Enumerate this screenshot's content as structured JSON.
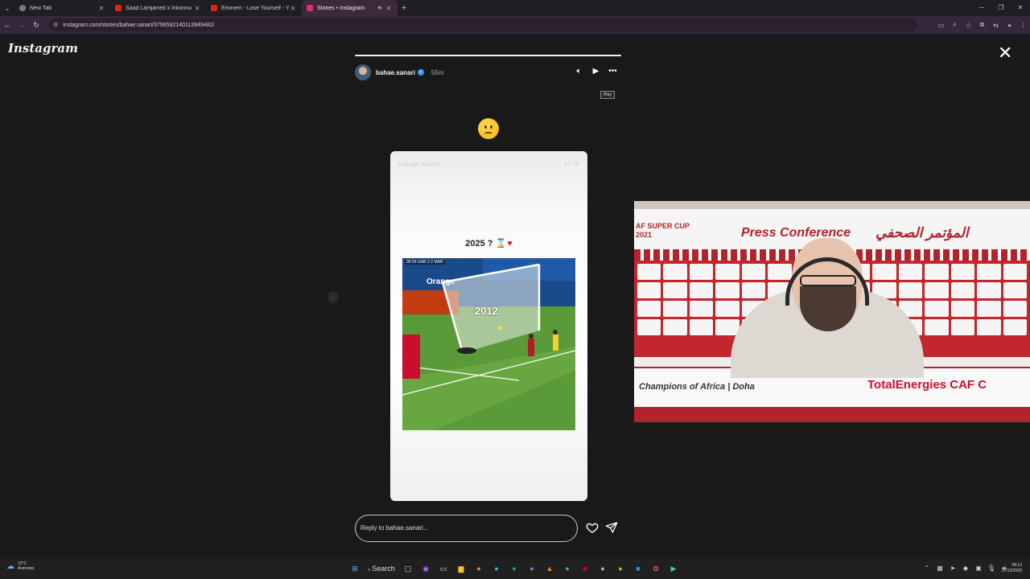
{
  "browser": {
    "tabs": [
      {
        "title": "New Tab",
        "favicon_color": "#7a7a7a",
        "active": false
      },
      {
        "title": "Saad Lamjarred x Inkonnu x Afri",
        "favicon_color": "#e62117",
        "active": false
      },
      {
        "title": "Eminem - Lose Yourself - YouTu",
        "favicon_color": "#e62117",
        "active": false
      },
      {
        "title": "Stories • Instagram",
        "favicon_color": "#e1306c",
        "active": true
      }
    ],
    "url": "instagram.com/stories/bahae.sanari/3796592140113949482/"
  },
  "page": {
    "logo": "Instagram",
    "close_icon": "close-icon"
  },
  "story": {
    "username": "bahae.sanari",
    "time_ago": "55m",
    "tooltip": "Play",
    "card": {
      "username": "bahae.sanari",
      "time": "14:25",
      "caption": "2025 ?",
      "video_scoreboard": "96:56 GAB 2-2 MAR",
      "video_year": "2012",
      "video_sponsor": "Orange"
    },
    "reply_placeholder": "Reply to bahae.sanari..."
  },
  "webcam": {
    "caf_text": "CAF SUPER CUP\n2021",
    "title_en": "Press Conference",
    "title_ar": "المؤتمر الصحفي",
    "footer_left": "Champions of Africa | Doha",
    "footer_right": "TotalEnergies CAF C"
  },
  "taskbar": {
    "weather_temp": "12°C",
    "weather_place": "Aversess",
    "search_label": "Search",
    "time": "08:13",
    "date": "27/12/2025"
  }
}
